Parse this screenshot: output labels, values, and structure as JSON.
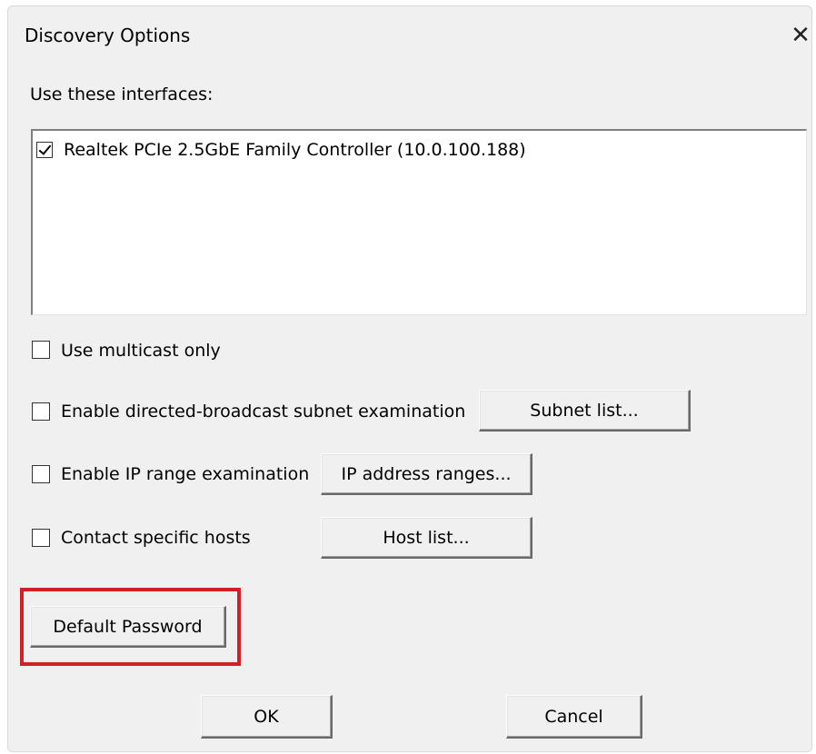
{
  "window": {
    "title": "Discovery Options",
    "close_icon": "close-icon",
    "close_glyph": "✕"
  },
  "interfaces": {
    "label": "Use these interfaces:",
    "items": [
      {
        "label": "Realtek PCIe 2.5GbE Family Controller (10.0.100.188)",
        "checked": true
      }
    ]
  },
  "options": {
    "multicast": {
      "label": "Use multicast only",
      "checked": false
    },
    "directed_broadcast": {
      "label": "Enable directed-broadcast subnet examination",
      "checked": false,
      "button_label": "Subnet list..."
    },
    "ip_range": {
      "label": "Enable IP range examination",
      "checked": false,
      "button_label": "IP address ranges..."
    },
    "specific_hosts": {
      "label": "Contact specific hosts",
      "checked": false,
      "button_label": "Host list..."
    }
  },
  "default_password_button": "Default Password",
  "footer": {
    "ok_label": "OK",
    "cancel_label": "Cancel"
  },
  "colors": {
    "highlight": "#d32027",
    "dialog_bg": "#f0f0f0"
  }
}
